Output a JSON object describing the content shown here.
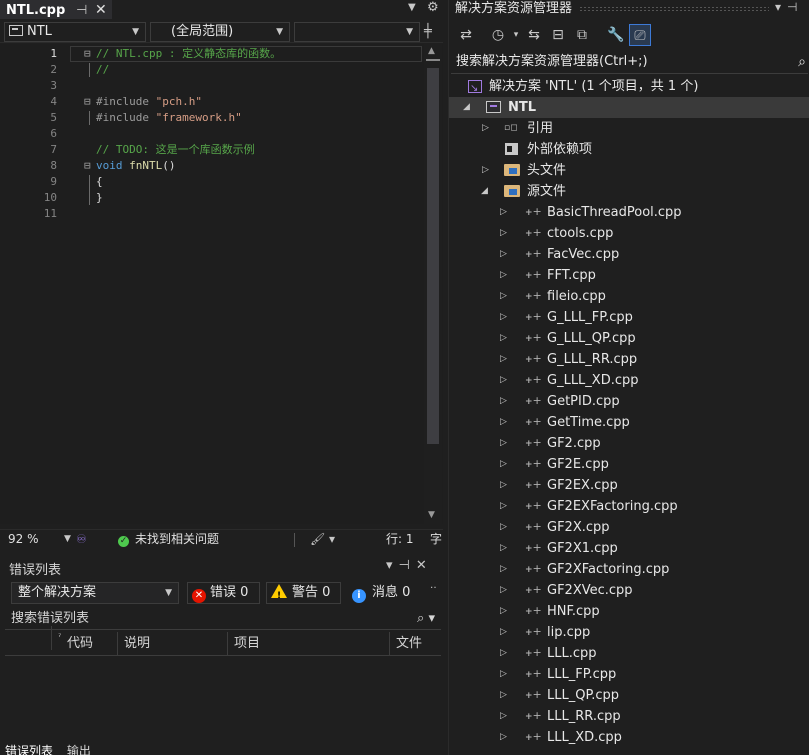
{
  "editor": {
    "tab_title": "NTL.cpp",
    "pin_glyph": "⊣",
    "close_glyph": "✕",
    "nav_project": "NTL",
    "nav_scope": "(全局范围)",
    "code_lines": [
      {
        "num": "1",
        "tokens": [
          {
            "cls": "c-com",
            "text": "// NTL.cpp : 定义静态库的函数。"
          }
        ]
      },
      {
        "num": "2",
        "tokens": [
          {
            "cls": "c-com",
            "text": "//"
          }
        ]
      },
      {
        "num": "3",
        "tokens": []
      },
      {
        "num": "4",
        "tokens": [
          {
            "cls": "c-pp",
            "text": "#include "
          },
          {
            "cls": "c-str",
            "text": "\"pch.h\""
          }
        ]
      },
      {
        "num": "5",
        "tokens": [
          {
            "cls": "c-pp",
            "text": "#include "
          },
          {
            "cls": "c-str",
            "text": "\"framework.h\""
          }
        ]
      },
      {
        "num": "6",
        "tokens": []
      },
      {
        "num": "7",
        "tokens": [
          {
            "cls": "c-com",
            "text": "// TODO: 这是一个库函数示例"
          }
        ]
      },
      {
        "num": "8",
        "tokens": [
          {
            "cls": "c-kw",
            "text": "void "
          },
          {
            "cls": "c-fn",
            "text": "fnNTL"
          },
          {
            "cls": "",
            "text": "()"
          }
        ]
      },
      {
        "num": "9",
        "tokens": [
          {
            "cls": "",
            "text": "{"
          }
        ]
      },
      {
        "num": "10",
        "tokens": [
          {
            "cls": "",
            "text": "}"
          }
        ]
      },
      {
        "num": "11",
        "tokens": []
      }
    ],
    "folded_lines": [
      "1",
      "4",
      "8"
    ]
  },
  "status": {
    "zoom": "92 %",
    "issues": "未找到相关问题",
    "line_label": "行: 1",
    "overflow_char": "字"
  },
  "error_list": {
    "title": "错误列表",
    "scope": "整个解决方案",
    "errors_label": "错误 0",
    "warnings_label": "警告 0",
    "messages_label": "消息 0",
    "search_placeholder": "搜索错误列表",
    "columns": [
      "代码",
      "说明",
      "项目",
      "文件"
    ],
    "bottom_tabs": [
      "错误列表",
      "输出"
    ]
  },
  "solution_explorer": {
    "title": "解决方案资源管理器",
    "search_placeholder": "搜索解决方案资源管理器(Ctrl+;)",
    "solution_label": "解决方案 'NTL' (1 个项目，共 1 个)",
    "project_label": "NTL",
    "nodes": {
      "references": "引用",
      "external_deps": "外部依赖项",
      "header_files": "头文件",
      "source_files": "源文件"
    },
    "source_files": [
      "BasicThreadPool.cpp",
      "ctools.cpp",
      "FacVec.cpp",
      "FFT.cpp",
      "fileio.cpp",
      "G_LLL_FP.cpp",
      "G_LLL_QP.cpp",
      "G_LLL_RR.cpp",
      "G_LLL_XD.cpp",
      "GetPID.cpp",
      "GetTime.cpp",
      "GF2.cpp",
      "GF2E.cpp",
      "GF2EX.cpp",
      "GF2EXFactoring.cpp",
      "GF2X.cpp",
      "GF2X1.cpp",
      "GF2XFactoring.cpp",
      "GF2XVec.cpp",
      "HNF.cpp",
      "lip.cpp",
      "LLL.cpp",
      "LLL_FP.cpp",
      "LLL_QP.cpp",
      "LLL_RR.cpp",
      "LLL_XD.cpp"
    ]
  }
}
